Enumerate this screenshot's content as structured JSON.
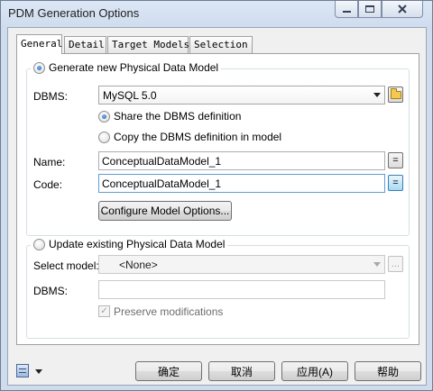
{
  "window": {
    "title": "PDM Generation Options"
  },
  "tabs": [
    {
      "label": "General",
      "active": true
    },
    {
      "label": "Detail",
      "active": false
    },
    {
      "label": "Target Models",
      "active": false
    },
    {
      "label": "Selection",
      "active": false
    }
  ],
  "generate_group": {
    "radio_label": "Generate new Physical Data Model",
    "selected": true,
    "dbms_label": "DBMS:",
    "dbms_value": "MySQL 5.0",
    "share_label": "Share the DBMS definition",
    "share_selected": true,
    "copy_label": "Copy the DBMS definition in model",
    "copy_selected": false,
    "name_label": "Name:",
    "name_value": "ConceptualDataModel_1",
    "code_label": "Code:",
    "code_value": "ConceptualDataModel_1",
    "equals_glyph": "=",
    "configure_label": "Configure Model Options..."
  },
  "update_group": {
    "radio_label": "Update existing Physical Data Model",
    "selected": false,
    "select_model_label": "Select model:",
    "select_model_value": "<None>",
    "ellipsis_glyph": "...",
    "dbms_label": "DBMS:",
    "dbms_value": "",
    "preserve_label": "Preserve modifications",
    "preserve_checked": true,
    "check_glyph": "✓"
  },
  "footer": {
    "ok_label": "确定",
    "cancel_label": "取消",
    "apply_label": "应用(A)",
    "help_label": "帮助"
  },
  "icons": {
    "minimize": "minimize-icon",
    "maximize": "maximize-icon",
    "close": "close-icon",
    "folder": "folder-icon",
    "properties_menu": "properties-menu-icon"
  },
  "colors": {
    "title_bar": "#cfdcee",
    "dialog_bg": "#f0f0f0",
    "focus_border": "#5f9cd6"
  }
}
